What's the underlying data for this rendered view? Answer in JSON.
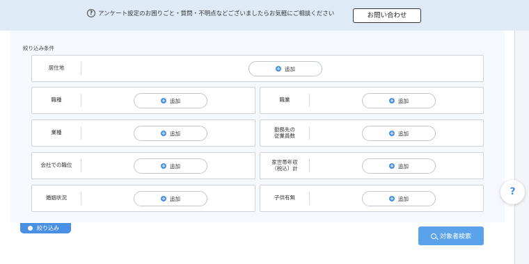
{
  "notice": {
    "icon": "help-circle-icon",
    "icon_glyph": "?",
    "text": "アンケート設定のお困りごと・質問・不明点などございましたらお気軽にご相談ください",
    "contact_label": "お問い合わせ"
  },
  "filter": {
    "title": "絞り込み条件",
    "add_label": "追加",
    "fields": {
      "residence": {
        "label": "居住地"
      },
      "job_type": {
        "label": "職種"
      },
      "occupation": {
        "label": "職業"
      },
      "industry": {
        "label": "業種"
      },
      "company_size": {
        "label": "勤務先の\n従業員数"
      },
      "position": {
        "label": "会社での職位"
      },
      "household_income": {
        "label": "家世帯年収\n（税込）計"
      },
      "marital_status": {
        "label": "婚姻状況"
      },
      "children": {
        "label": "子供有無"
      }
    }
  },
  "footer": {
    "narrow_label": "絞り込み",
    "search_label": "対象者検索"
  },
  "help_float": {
    "glyph": "?"
  },
  "colors": {
    "accent": "#4a90e2",
    "notice_bg": "#dfeaf7",
    "panel_bg": "#f5f8fc"
  }
}
